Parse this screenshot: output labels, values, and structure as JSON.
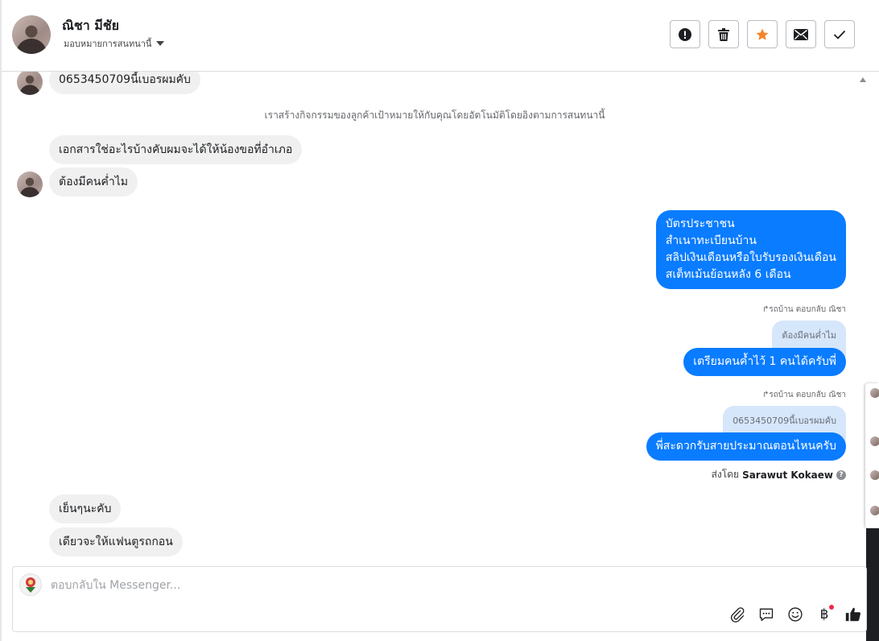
{
  "header": {
    "contact_name": "ณิชา มีชัย",
    "assign_label": "มอบหมายการสนทนานี้",
    "accent_color": "#f5822a"
  },
  "messages": {
    "m1": "0653450709นี้เบอรผมคับ",
    "system_note": "เราสร้างกิจกรรมของลูกค้าเป้าหมายให้กับคุณโดยอัตโนมัติโดยอิงตามการสนทนานี้",
    "m2": "เอกสารใช่อะไรบ้างคับผมจะได้ให้น้องขอที่อำเภอ",
    "m3": "ต้องมีคนค่ำไม",
    "out1_lines": [
      "บัตรประชาชน",
      "สำเนาทะเบียนบ้าน",
      "สลิปเงินเดือนหรือใบรับรองเงินเดือน",
      "สเต็ทเม้นย้อนหลัง 6 เดือน"
    ],
    "reply_meta_1": "รถบ้าน ตอบกลับ ณิชา",
    "quote_1": "ต้องมีคนค่ำไม",
    "out2": "เตรียมคนค้ำไว้ 1 คนได้ครับพี่",
    "reply_meta_2": "รถบ้าน ตอบกลับ ณิชา",
    "quote_2": "0653450709นี้เบอรผมคับ",
    "out3": "พี่สะดวกรับสายประมาณตอนไหนครับ",
    "sent_by_prefix": "ส่งโดย",
    "sent_by_name": "Sarawut Kokaew",
    "m4": "เย็นๆนะคับ",
    "m5": "เดียวจะให้แฟนตูรถกอน"
  },
  "composer": {
    "placeholder": "ตอบกลับใน Messenger..."
  },
  "colors": {
    "outgoing": "#0a7cff",
    "incoming": "#f0f0f0",
    "quote": "#d6e6fb"
  }
}
